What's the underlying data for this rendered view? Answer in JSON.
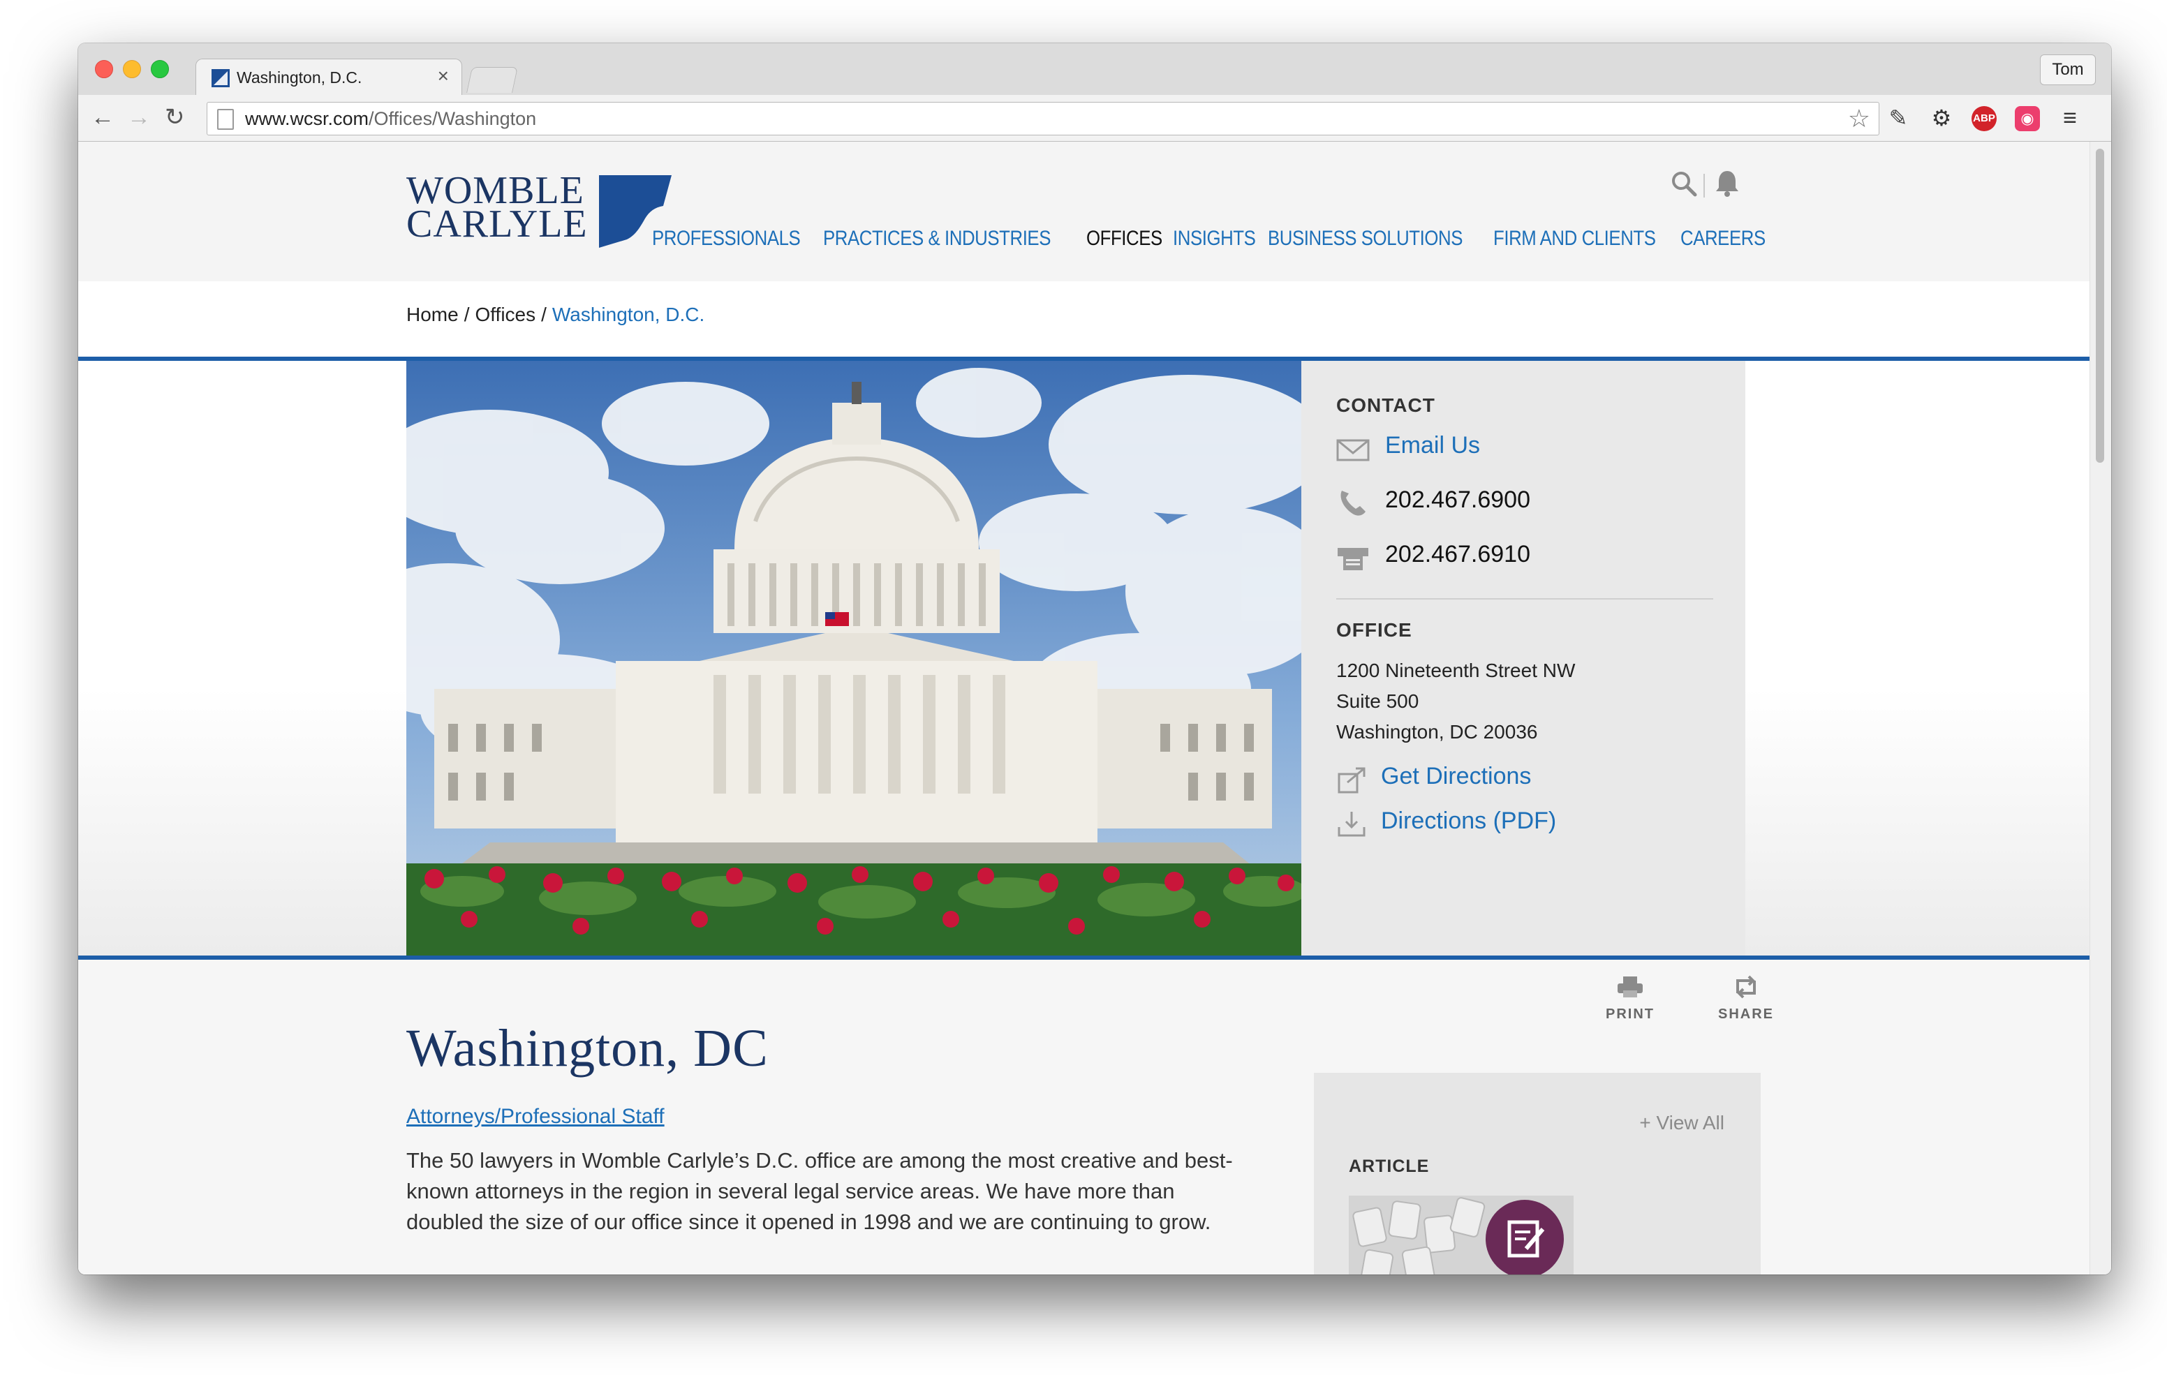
{
  "browser": {
    "tab_title": "Washington, D.C.",
    "tab_close": "×",
    "profile_name": "Tom",
    "url_host": "www.wcsr.com",
    "url_path": "/Offices/Washington",
    "extensions": {
      "abp_label": "ABP"
    }
  },
  "site": {
    "logo_line1": "WOMBLE",
    "logo_line2": "CARLYLE",
    "nav": [
      {
        "label": "PROFESSIONALS"
      },
      {
        "label": "PRACTICES & INDUSTRIES"
      },
      {
        "label": "OFFICES"
      },
      {
        "label": "INSIGHTS"
      },
      {
        "label": "BUSINESS SOLUTIONS"
      },
      {
        "label": "FIRM AND CLIENTS"
      },
      {
        "label": "CAREERS"
      }
    ],
    "active_nav": "OFFICES",
    "accent_color": "#1d6fb8",
    "brand_navy": "#1b3563"
  },
  "breadcrumb": {
    "home": "Home",
    "offices": "Offices",
    "current": "Washington, D.C.",
    "sep": "/"
  },
  "contact": {
    "heading": "CONTACT",
    "email_label": "Email Us",
    "phone": "202.467.6900",
    "fax": "202.467.6910"
  },
  "office": {
    "heading": "OFFICE",
    "address_line1": "1200 Nineteenth Street NW",
    "address_line2": "Suite 500",
    "address_line3": "Washington, DC 20036",
    "directions_label": "Get Directions",
    "directions_pdf_label": "Directions (PDF)"
  },
  "tools": {
    "print_label": "PRINT",
    "share_label": "SHARE"
  },
  "main": {
    "title": "Washington, DC",
    "staff_link": "Attorneys/Professional Staff",
    "intro": "The 50 lawyers in Womble Carlyle’s D.C. office are among the most creative and best-known attorneys in the region in several legal service areas. We have more than doubled the size of our office since it opened in 1998 and we are continuing to grow."
  },
  "sidebar": {
    "view_all": "+ View All",
    "article_heading": "ARTICLE"
  }
}
